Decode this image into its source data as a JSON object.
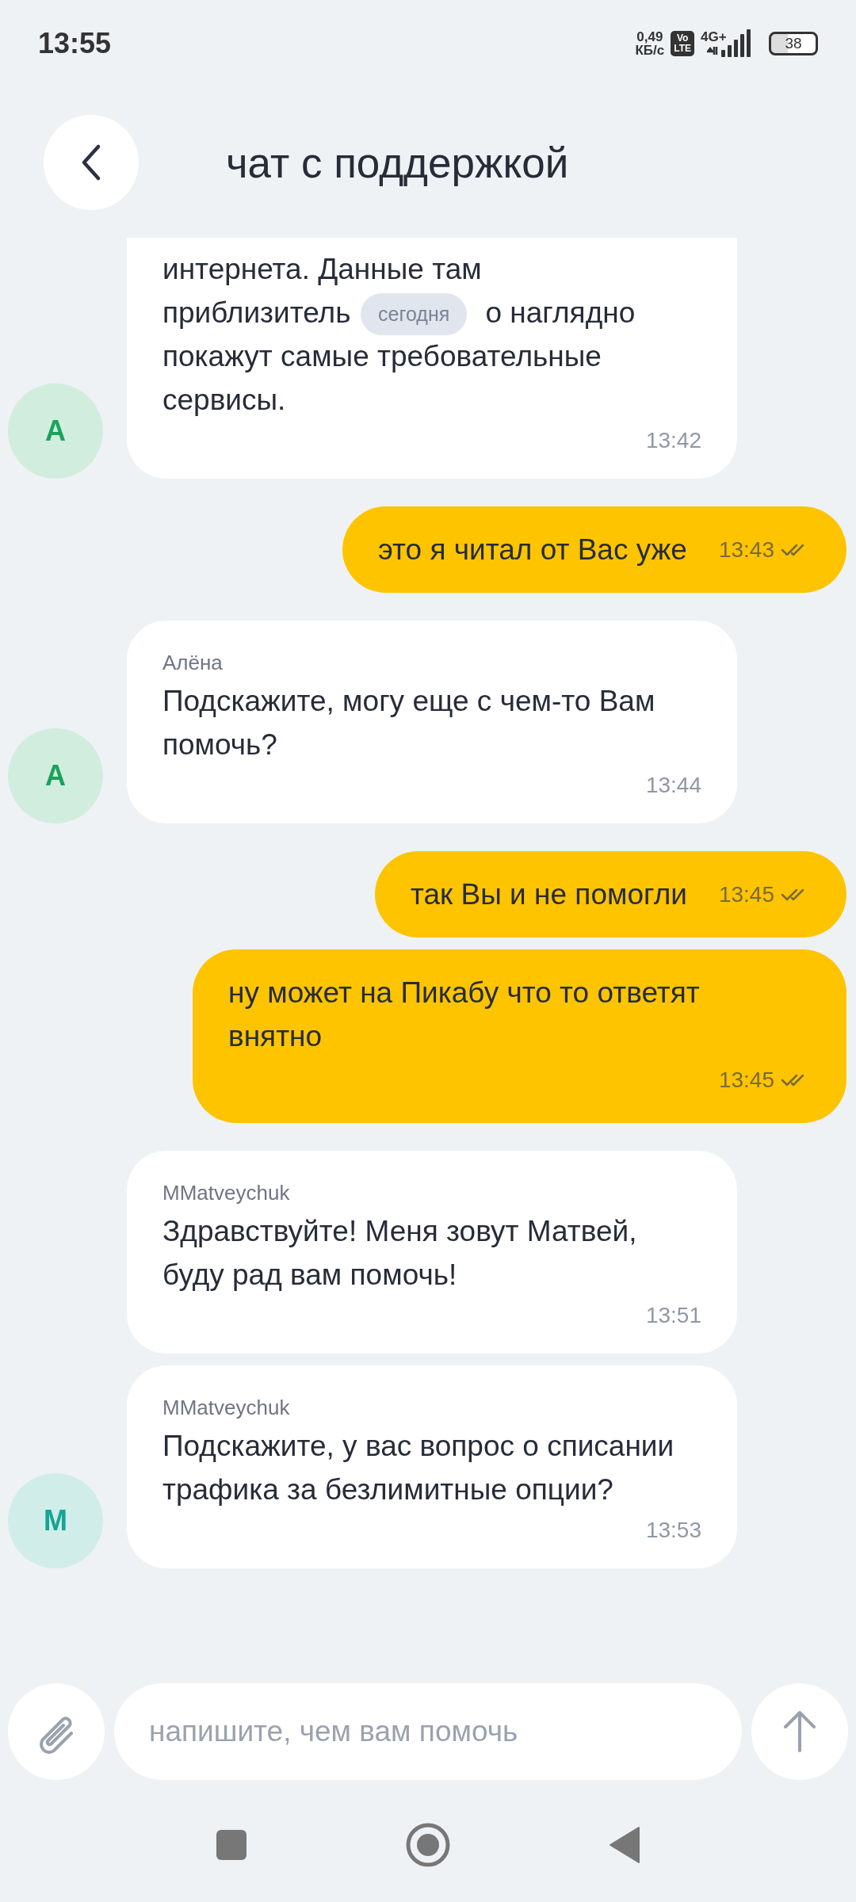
{
  "status_bar": {
    "time": "13:55",
    "speed_value": "0,49",
    "speed_unit": "КБ/с",
    "volte_top": "Vo",
    "volte_bottom": "LTE",
    "network": "4G+",
    "battery": "38"
  },
  "header": {
    "title": "чат с поддержкой"
  },
  "date_pill": "сегодня",
  "messages": [
    {
      "kind": "incoming",
      "cut": true,
      "lines": [
        [
          "интернета. Данные там"
        ],
        [
          "приблизитель",
          "о наглядно"
        ],
        [
          "покажут самые требовательные"
        ],
        [
          "сервисы."
        ]
      ],
      "time": "13:42",
      "avatar": {
        "letter": "А",
        "color": "#1aa35a"
      }
    },
    {
      "kind": "outgoing",
      "text": "это я читал от Вас уже",
      "time": "13:43"
    },
    {
      "kind": "incoming",
      "author": "Алёна",
      "text": "Подскажите, могу еще с чем-то Вам помочь?",
      "time": "13:44",
      "avatar": {
        "letter": "А",
        "color": "#1aa35a"
      }
    },
    {
      "kind": "outgoing",
      "text": "так Вы и не помогли",
      "time": "13:45"
    },
    {
      "kind": "outgoing",
      "text": "ну может на Пикабу что то ответят внятно",
      "time": "13:45"
    },
    {
      "kind": "incoming",
      "author": "MMatveychuk",
      "text": "Здравствуйте! Меня зовут Матвей, буду рад вам помочь!",
      "time": "13:51"
    },
    {
      "kind": "incoming",
      "author": "MMatveychuk",
      "text": "Подскажите, у вас вопрос о списании трафика за безлимитные опции?",
      "time": "13:53",
      "avatar": {
        "letter": "М",
        "color": "#16a596"
      }
    }
  ],
  "composer": {
    "placeholder": "напишите, чем вам помочь"
  }
}
